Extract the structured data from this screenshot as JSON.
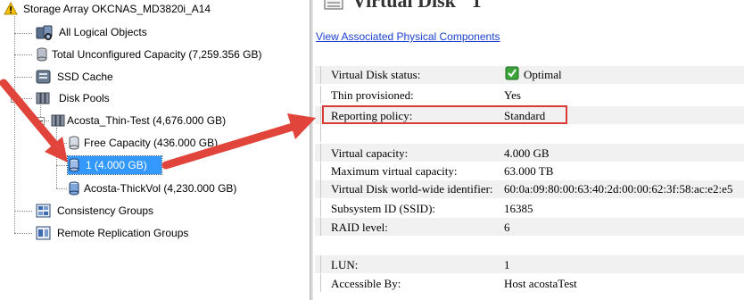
{
  "tree": {
    "root": "Storage Array OKCNAS_MD3820i_A14",
    "items": {
      "all_logical": "All Logical Objects",
      "unconfigured": "Total Unconfigured Capacity (7,259.356 GB)",
      "ssd_cache": "SSD Cache",
      "disk_pools": "Disk Pools",
      "pool": "Acosta_Thin-Test (4,676.000 GB)",
      "free_capacity": "Free Capacity (436.000 GB)",
      "vdisk1": "1 (4.000 GB)",
      "thickvol": "Acosta-ThickVol (4,230.000 GB)",
      "consistency": "Consistency Groups",
      "remote": "Remote Replication Groups"
    }
  },
  "details": {
    "heading": "Virtual Disk \"1\"",
    "link": "View Associated Physical Components",
    "props": [
      {
        "label": "Virtual Disk status:",
        "value": "Optimal"
      },
      {
        "label": "Thin provisioned:",
        "value": "Yes"
      },
      {
        "label": "Reporting policy:",
        "value": "Standard"
      },
      {
        "label": "Virtual capacity:",
        "value": "4.000 GB"
      },
      {
        "label": "Maximum virtual capacity:",
        "value": "63.000 TB"
      },
      {
        "label": "Virtual Disk world-wide identifier:",
        "value": "60:0a:09:80:00:63:40:2d:00:00:62:3f:58:ac:e2:e5"
      },
      {
        "label": "Subsystem ID (SSID):",
        "value": "16385"
      },
      {
        "label": "RAID level:",
        "value": "6"
      },
      {
        "label": "LUN:",
        "value": "1"
      },
      {
        "label": "Accessible By:",
        "value": "Host acostaTest"
      }
    ]
  },
  "colors": {
    "annotation_arrow": "#e0443a",
    "selection": "#3399ff",
    "link": "#1a3fd0",
    "ok_green": "#3aa53a"
  }
}
